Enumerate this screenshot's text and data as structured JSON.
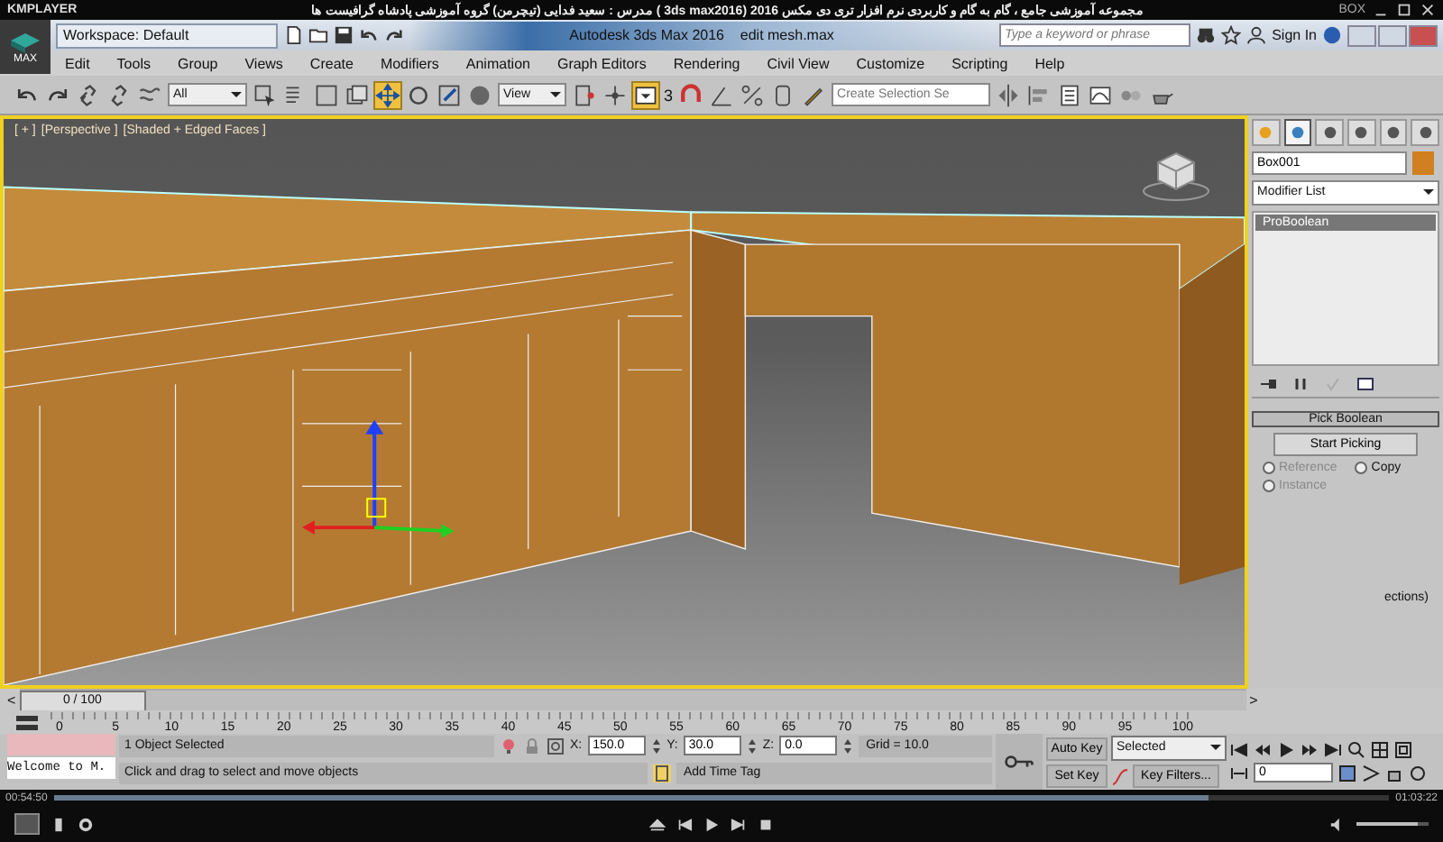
{
  "player": {
    "app_name": "KMPLAYER",
    "title": "مجموعه آموزشی جامع ، گام به گام و کاربردی نرم افزار تری دی مکس 2016 (3ds max2016 )  مدرس : سعید فدایی (تیچرمن) گروه آموزشی پادشاه گرافیست ها",
    "box_label": "BOX",
    "elapsed": "00:54:50",
    "total": "01:03:22",
    "level": 0.865,
    "volume": {
      "level": 0.85
    }
  },
  "window": {
    "logo": "MAX",
    "workspace": "Workspace: Default",
    "title": "Autodesk 3ds Max 2016",
    "file": "edit mesh.max",
    "search": {
      "placeholder": "Type a keyword or phrase"
    },
    "sign_in": "Sign In"
  },
  "menu": [
    "Edit",
    "Tools",
    "Group",
    "Views",
    "Create",
    "Modifiers",
    "Animation",
    "Graph Editors",
    "Rendering",
    "Civil View",
    "Customize",
    "Scripting",
    "Help"
  ],
  "toolbar": {
    "filter": "All",
    "coord": "View",
    "snap_label": "3",
    "selection_set": {
      "placeholder": "Create Selection Se"
    }
  },
  "viewport": {
    "labels": [
      "[ + ]",
      "[Perspective ]",
      "[Shaded + Edged Faces ]"
    ]
  },
  "command_panel": {
    "tabs": [
      {
        "selected": false
      },
      {
        "selected": true
      },
      {
        "selected": false
      },
      {
        "selected": false
      },
      {
        "selected": false
      },
      {
        "selected": false
      }
    ],
    "object_name": "Box001",
    "modifier_list": "Modifier List",
    "stack": [
      {
        "label": "ProBoolean",
        "selected": true
      }
    ],
    "rollout": {
      "title": "Pick Boolean",
      "button": "Start Picking",
      "options": [
        {
          "label": "Reference",
          "selected": false,
          "disabled": true
        },
        {
          "label": "Copy",
          "selected": false,
          "disabled": false
        },
        {
          "label": "Instance",
          "selected": false,
          "disabled": true
        }
      ],
      "footer": "ections)"
    }
  },
  "timeline": {
    "prev": "<",
    "next": ">",
    "position": "0 / 100",
    "level": 0,
    "ticks": [
      "0",
      "5",
      "10",
      "15",
      "20",
      "25",
      "30",
      "35",
      "40",
      "45",
      "50",
      "55",
      "60",
      "65",
      "70",
      "75",
      "80",
      "85",
      "90",
      "95",
      "100"
    ]
  },
  "status": {
    "listener": "Welcome to M.",
    "selection": "1 Object Selected",
    "prompt": "Click and drag to select and move objects",
    "coords": [
      {
        "axis": "X:",
        "value": "150.0"
      },
      {
        "axis": "Y:",
        "value": "30.0"
      },
      {
        "axis": "Z:",
        "value": "0.0"
      }
    ],
    "grid": "Grid = 10.0",
    "time_tag": "Add Time Tag",
    "auto_key": "Auto Key",
    "set_key": "Set Key",
    "key_mode": "Selected",
    "key_filters": "Key Filters...",
    "frame": "0"
  }
}
